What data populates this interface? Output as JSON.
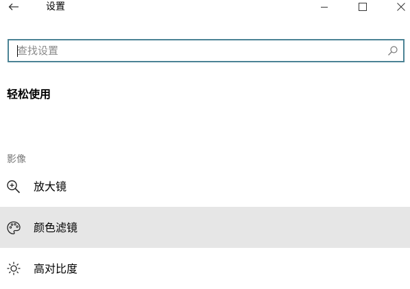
{
  "window": {
    "title": "设置",
    "back_icon": "back-arrow-icon",
    "minimize_icon": "minimize-icon",
    "maximize_icon": "maximize-icon",
    "close_icon": "close-icon"
  },
  "search": {
    "placeholder": "查找设置",
    "value": "",
    "icon": "search-icon"
  },
  "page": {
    "title": "轻松使用"
  },
  "group": {
    "label": "影像",
    "items": [
      {
        "label": "放大镜",
        "icon": "magnifier-icon",
        "selected": false
      },
      {
        "label": "颜色滤镜",
        "icon": "color-palette-icon",
        "selected": true
      },
      {
        "label": "高对比度",
        "icon": "brightness-icon",
        "selected": false
      }
    ]
  },
  "colors": {
    "search_border": "#4a8294",
    "selected_bg": "#e6e6e6",
    "group_label": "#777777"
  }
}
